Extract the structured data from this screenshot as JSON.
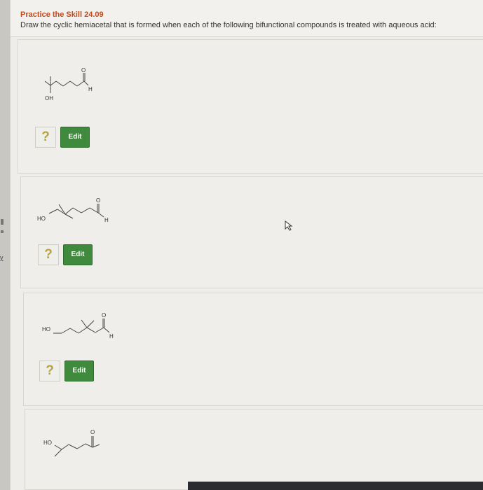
{
  "header": {
    "title": "Practice the Skill 24.09",
    "instructions": "Draw the cyclic hemiacetal that is formed when each of the following bifunctional compounds is treated with aqueous acid:"
  },
  "compounds": [
    {
      "labels": {
        "oxygen": "O",
        "aldehyde_h": "H",
        "hydroxyl": "OH"
      },
      "help_glyph": "?",
      "edit_label": "Edit"
    },
    {
      "labels": {
        "oxygen": "O",
        "aldehyde_h": "H",
        "hydroxyl": "HO"
      },
      "help_glyph": "?",
      "edit_label": "Edit"
    },
    {
      "labels": {
        "oxygen": "O",
        "aldehyde_h": "H",
        "hydroxyl": "HO"
      },
      "help_glyph": "?",
      "edit_label": "Edit"
    },
    {
      "labels": {
        "oxygen": "O",
        "hydroxyl": "HO"
      }
    }
  ],
  "side": {
    "letter": "y"
  }
}
